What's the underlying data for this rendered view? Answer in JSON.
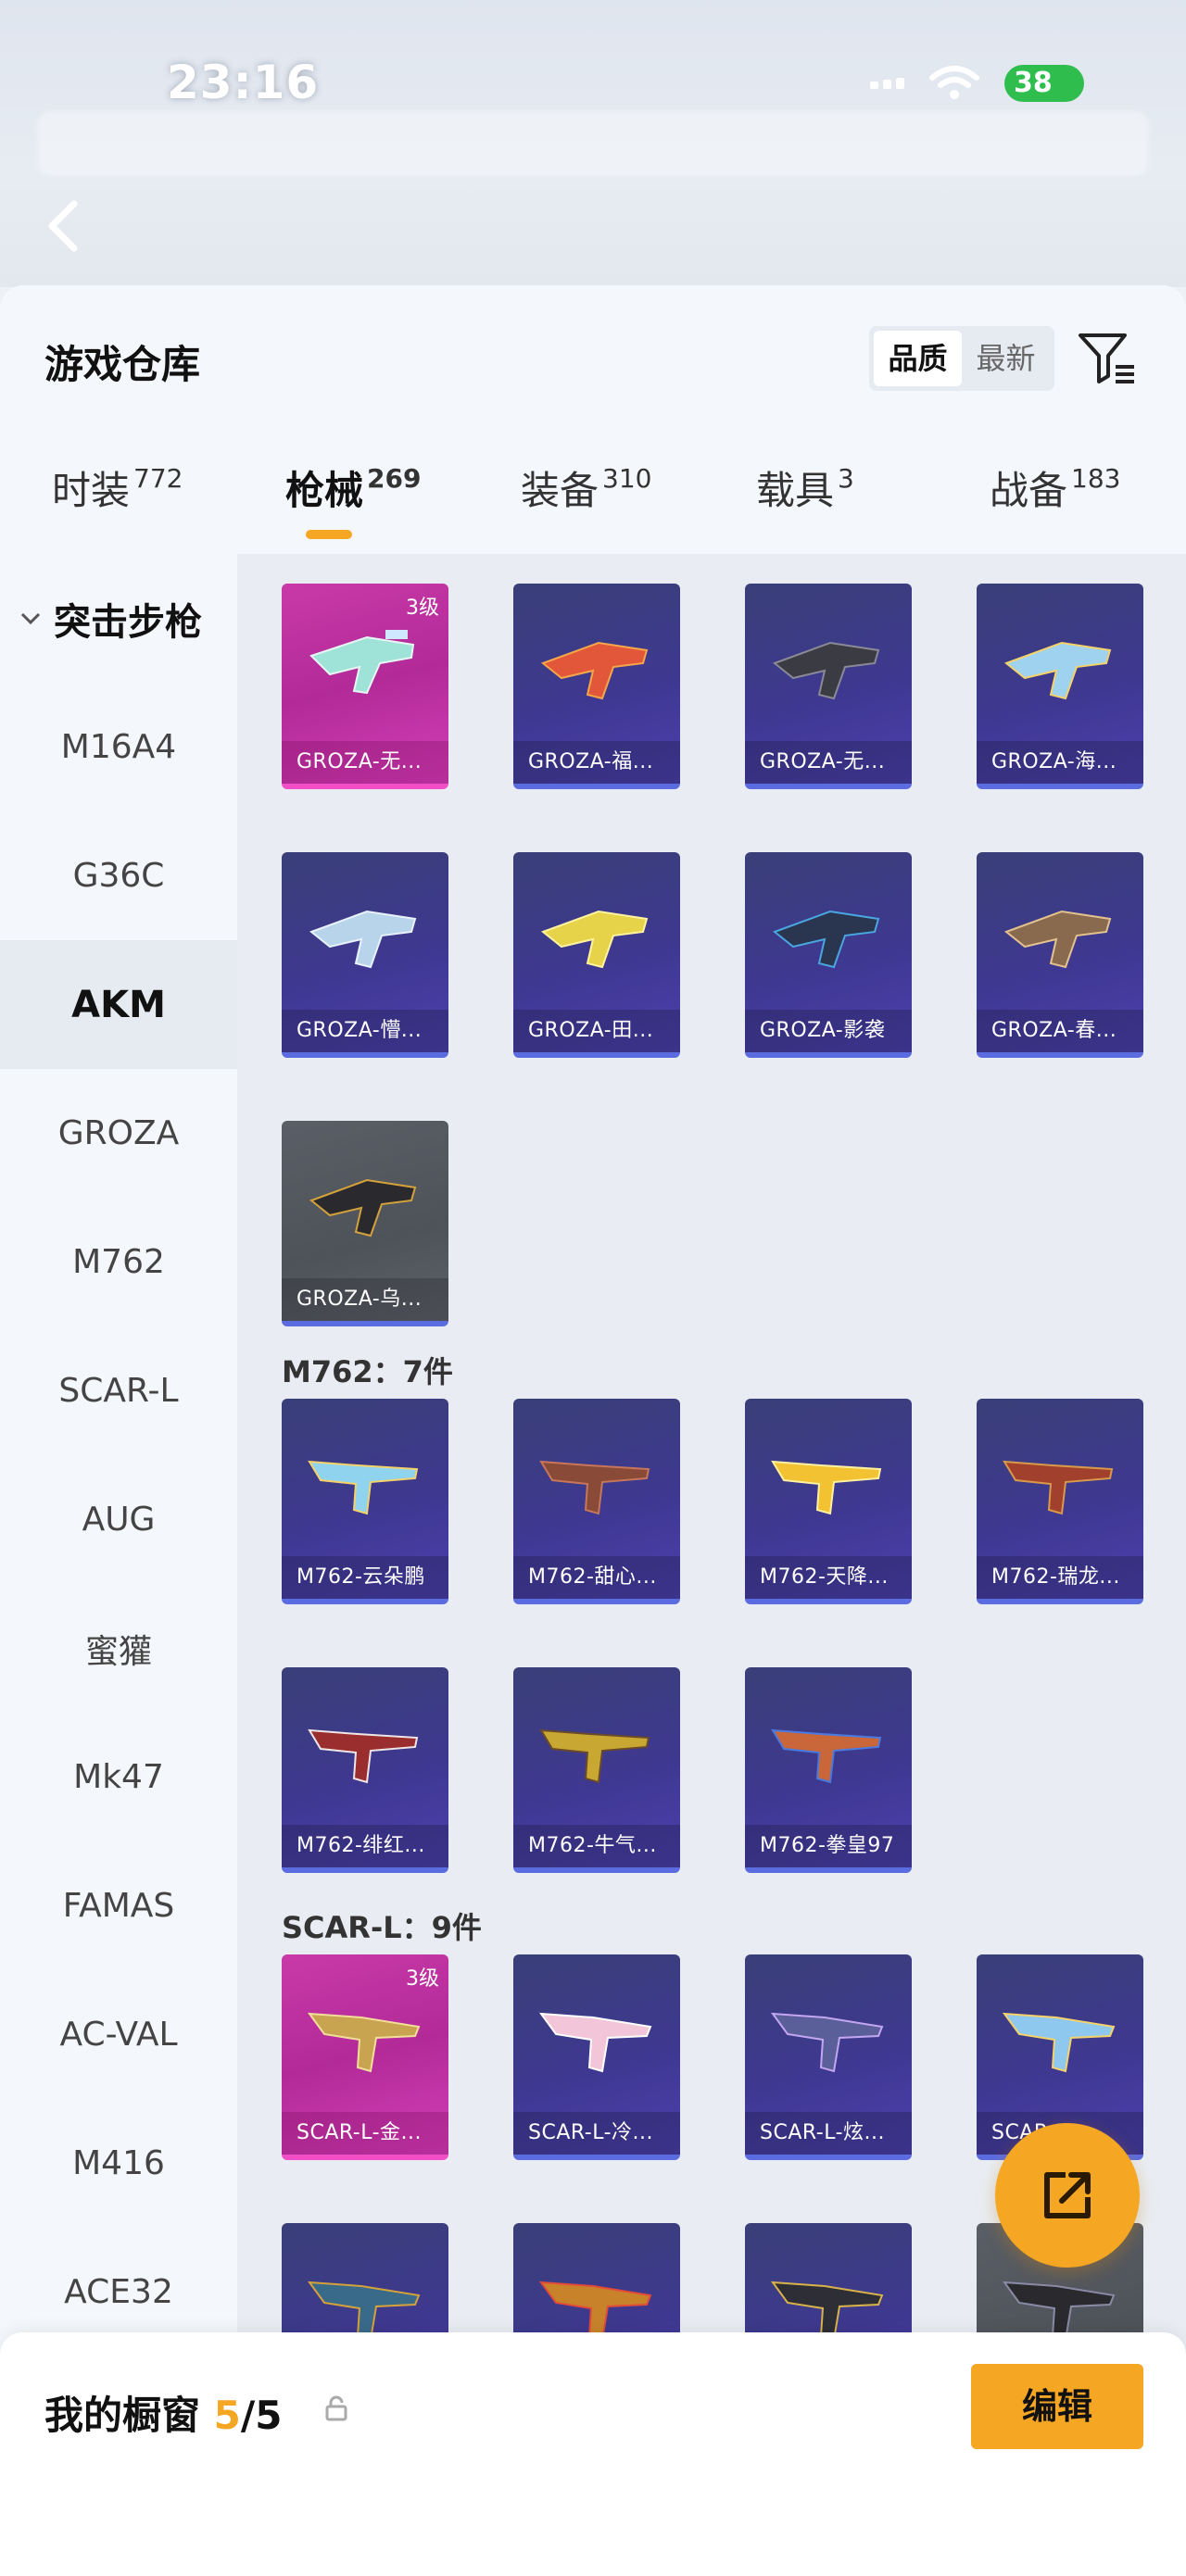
{
  "status_bar": {
    "time": "23:16",
    "battery": "38"
  },
  "sheet": {
    "title": "游戏仓库",
    "sort": {
      "options": [
        "品质",
        "最新"
      ],
      "selected": "品质"
    }
  },
  "tabs": [
    {
      "label": "时装",
      "count": "772"
    },
    {
      "label": "枪械",
      "count": "269",
      "active": true
    },
    {
      "label": "装备",
      "count": "310"
    },
    {
      "label": "载具",
      "count": "3"
    },
    {
      "label": "战备",
      "count": "183"
    }
  ],
  "sidebar": {
    "group": "突击步枪",
    "items": [
      "M16A4",
      "G36C",
      "AKM",
      "GROZA",
      "M762",
      "SCAR-L",
      "AUG",
      "蜜獾",
      "Mk47",
      "FAMAS",
      "AC-VAL",
      "M416",
      "ACE32"
    ],
    "active": "AKM"
  },
  "sections": {
    "groza_cards": [
      {
        "name": "GROZA-无...",
        "level": "3级",
        "rarity": "pink"
      },
      {
        "name": "GROZA-福...",
        "rarity": "blue"
      },
      {
        "name": "GROZA-无...",
        "rarity": "blue"
      },
      {
        "name": "GROZA-海...",
        "rarity": "blue"
      },
      {
        "name": "GROZA-懵...",
        "rarity": "blue"
      },
      {
        "name": "GROZA-田...",
        "rarity": "blue"
      },
      {
        "name": "GROZA-影袭",
        "rarity": "blue"
      },
      {
        "name": "GROZA-春...",
        "rarity": "blue"
      },
      {
        "name": "GROZA-乌...",
        "rarity": "grey"
      }
    ],
    "m762_title": "M762：7件",
    "m762_cards": [
      {
        "name": "M762-云朵鹏",
        "rarity": "blue"
      },
      {
        "name": "M762-甜心...",
        "rarity": "blue"
      },
      {
        "name": "M762-天降...",
        "rarity": "blue"
      },
      {
        "name": "M762-瑞龙...",
        "rarity": "blue"
      },
      {
        "name": "M762-绯红...",
        "rarity": "blue"
      },
      {
        "name": "M762-牛气...",
        "rarity": "blue"
      },
      {
        "name": "M762-拳皇97",
        "rarity": "blue"
      }
    ],
    "scar_title": "SCAR-L：9件",
    "scar_cards": [
      {
        "name": "SCAR-L-金...",
        "level": "3级",
        "rarity": "pink"
      },
      {
        "name": "SCAR-L-冷...",
        "rarity": "blue"
      },
      {
        "name": "SCAR-L-炫...",
        "rarity": "blue"
      },
      {
        "name": "SCAR-L-...",
        "rarity": "blue"
      }
    ]
  },
  "bottom_bar": {
    "label": "我的橱窗",
    "count_current": "5",
    "count_sep_total": "/5",
    "edit_label": "编辑"
  },
  "colors": {
    "accent": "#f5a623",
    "blue_card": "#3e3890",
    "pink_card": "#c93aa8",
    "grey_card": "#55595f"
  }
}
